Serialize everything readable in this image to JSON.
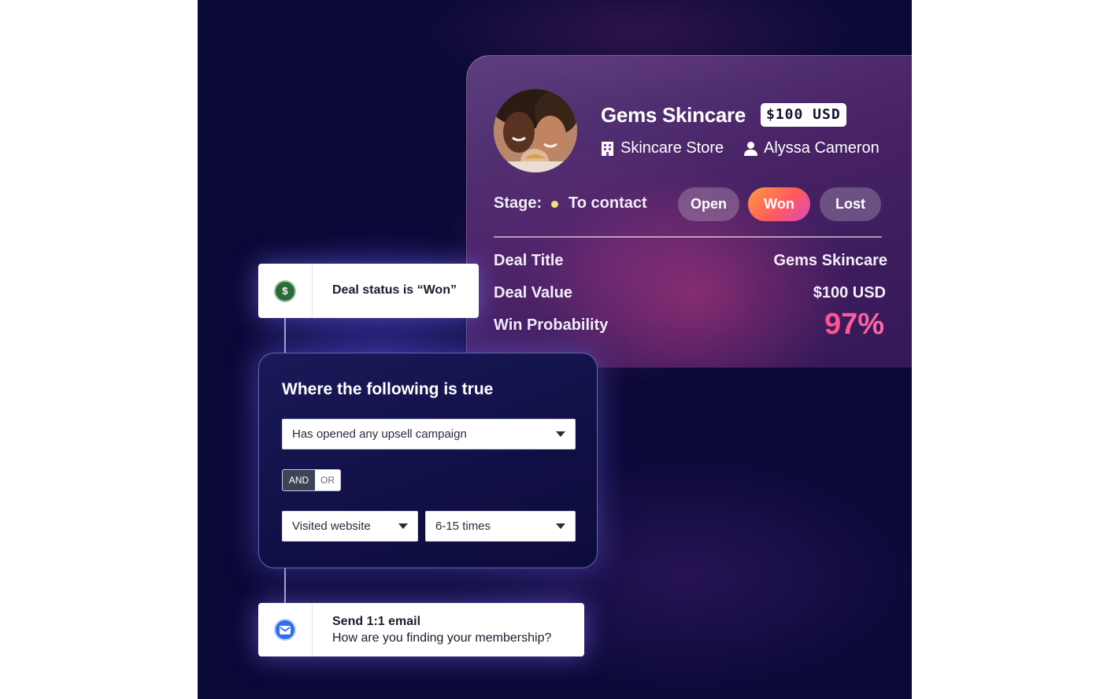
{
  "deal": {
    "company_name": "Gems Skincare",
    "badge": "$100 USD",
    "company_type": "Skincare Store",
    "contact_name": "Alyssa Cameron",
    "stage_label": "Stage:",
    "stage_value": "To contact",
    "status_options": [
      {
        "label": "Open",
        "selected": false
      },
      {
        "label": "Won",
        "selected": true
      },
      {
        "label": "Lost",
        "selected": false
      }
    ],
    "fields": {
      "title_label": "Deal Title",
      "title_value": "Gems Skincare",
      "value_label": "Deal Value",
      "value_value": "$100 USD",
      "probability_label": "Win Probability",
      "probability_value": "97%"
    }
  },
  "workflow": {
    "trigger": {
      "text": "Deal status is “Won”",
      "icon": "dollar-icon"
    },
    "condition": {
      "title": "Where the following is true",
      "first_select": "Has opened any upsell campaign",
      "operator_options": [
        "AND",
        "OR"
      ],
      "operator_selected": "AND",
      "second_select": "Visited website",
      "third_select": "6-15 times"
    },
    "action": {
      "title": "Send 1:1 email",
      "subject": "How are you finding your membership?",
      "icon": "mail-icon"
    }
  },
  "colors": {
    "background": "#0b0938",
    "won_gradient": [
      "#ff9a3c",
      "#ff5a5f",
      "#d94bbf"
    ],
    "probability": "#ff5a99",
    "stage_dot": "#f2e17a",
    "trigger_icon": "#2d6a3a",
    "email_icon": "#2f6cf2"
  }
}
